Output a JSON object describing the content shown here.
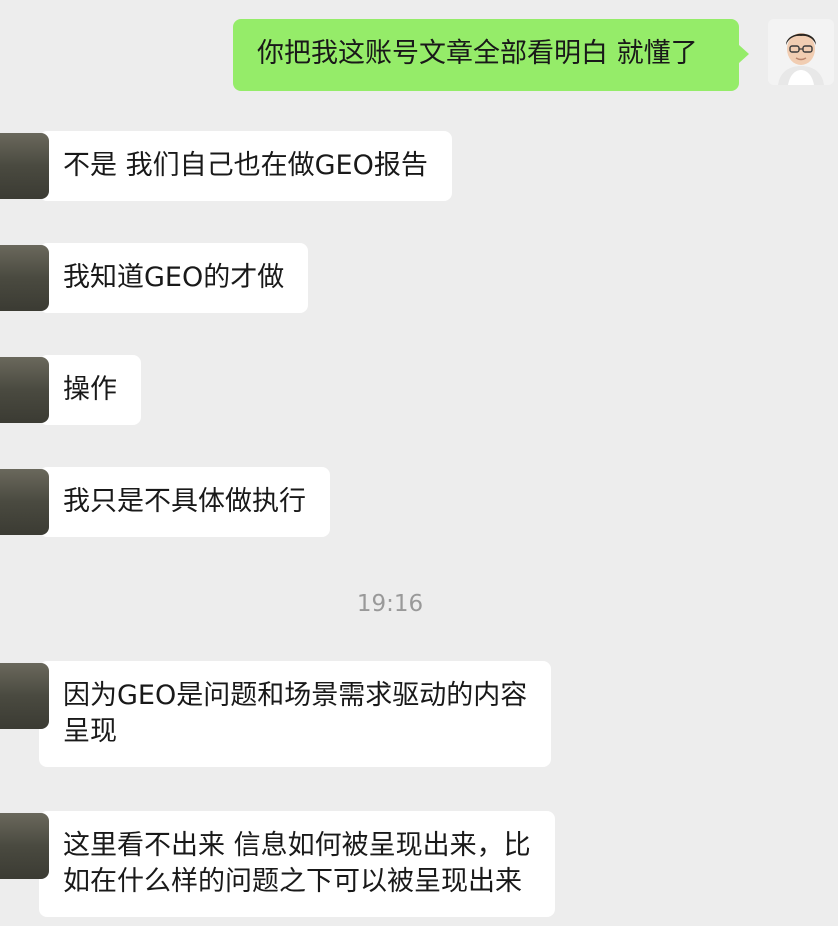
{
  "colors": {
    "background": "#ededed",
    "self_bubble": "#95ec69",
    "peer_bubble": "#ffffff",
    "text": "#191919",
    "timestamp": "#999999"
  },
  "messages": [
    {
      "sender": "self",
      "lines": [
        "你把我这账号文章全部看明白 就懂了"
      ]
    },
    {
      "sender": "peer",
      "lines": [
        "不是 我们自己也在做GEO报告"
      ]
    },
    {
      "sender": "peer",
      "lines": [
        "我知道GEO的才做"
      ]
    },
    {
      "sender": "peer",
      "lines": [
        "操作"
      ]
    },
    {
      "sender": "peer",
      "lines": [
        "我只是不具体做执行"
      ]
    },
    {
      "sender": "peer",
      "lines": [
        "因为GEO是问题和场景需求驱动的内容",
        "呈现"
      ]
    },
    {
      "sender": "peer",
      "lines": [
        "这里看不出来 信息如何被呈现出来，比",
        "如在什么样的问题之下可以被呈现出来"
      ]
    }
  ],
  "timestamp": "19:16",
  "icons": {
    "self_avatar": "user-avatar-icon",
    "peer_avatar": "contact-avatar-icon"
  }
}
